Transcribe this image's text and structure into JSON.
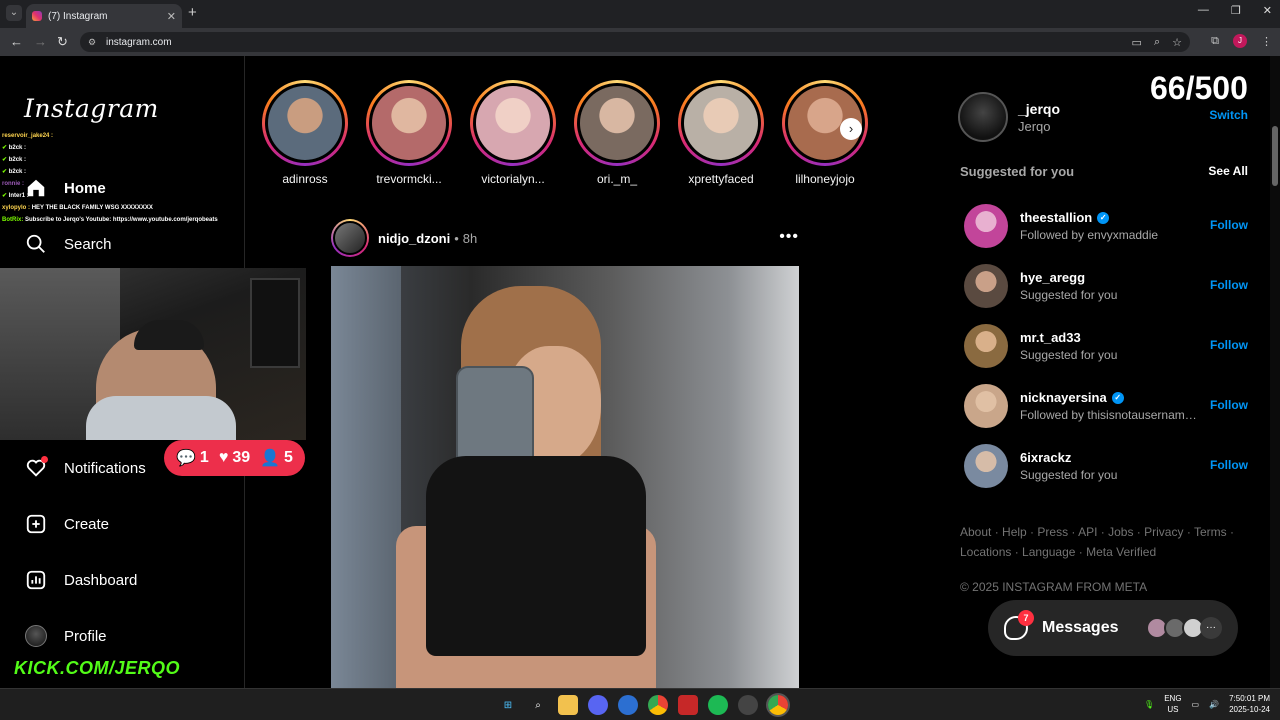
{
  "browser": {
    "tab_title": "(7) Instagram",
    "tab_close": "✕",
    "new_tab": "+",
    "url": "instagram.com",
    "profile_initial": "J"
  },
  "sidebar": {
    "logo": "Instagram",
    "items": [
      {
        "label": "Home",
        "icon": "home-icon"
      },
      {
        "label": "Search",
        "icon": "search-icon"
      },
      {
        "label": "Notifications",
        "icon": "heart-icon"
      },
      {
        "label": "Create",
        "icon": "plus-square-icon"
      },
      {
        "label": "Dashboard",
        "icon": "chart-icon"
      },
      {
        "label": "Profile",
        "icon": "avatar-icon"
      }
    ]
  },
  "overlay": {
    "chat": [
      {
        "user": "reservoir_jake24 :",
        "msg": ""
      },
      {
        "user": "b2ck :",
        "msg": ""
      },
      {
        "user": "b2ck :",
        "msg": ""
      },
      {
        "user": "b2ck :",
        "msg": ""
      },
      {
        "user": "ronnie :",
        "msg": ""
      },
      {
        "user": "Inter1 :",
        "msg": ""
      },
      {
        "user": "xylopylo :",
        "msg": "HEY THE BLACK FAMILY WSG XXXXXXXX"
      },
      {
        "user": "BotRix:",
        "msg": "Subscribe to Jerqo's Youtube: https://www.youtube.com/jerqobeats"
      }
    ],
    "badge": {
      "comments": "1",
      "likes": "39",
      "follows": "5"
    },
    "kick_url": "KICK.COM/JERQO"
  },
  "stories": [
    {
      "name": "adinross",
      "color": "#5b6b7c"
    },
    {
      "name": "trevormcki...",
      "color": "#b46a6a"
    },
    {
      "name": "victorialyn...",
      "color": "#d7a7b0"
    },
    {
      "name": "ori._m_",
      "color": "#7a6a60"
    },
    {
      "name": "xprettyfaced",
      "color": "#b9b0a6"
    },
    {
      "name": "lilhoneyjojo",
      "color": "#a86b4e"
    }
  ],
  "post": {
    "username": "nidjo_dzoni",
    "dot": "•",
    "time": "8h",
    "more": "•••"
  },
  "right": {
    "counter": "66/500",
    "me": {
      "username": "_jerqo",
      "name": "Jerqo",
      "switch": "Switch"
    },
    "suggested_title": "Suggested for you",
    "see_all": "See All",
    "suggestions": [
      {
        "username": "theestallion",
        "sub": "Followed by envyxmaddie",
        "verified": true,
        "follow": "Follow",
        "color": "#c2459a"
      },
      {
        "username": "hye_aregg",
        "sub": "Suggested for you",
        "verified": false,
        "follow": "Follow",
        "color": "#5a4a40"
      },
      {
        "username": "mr.t_ad33",
        "sub": "Suggested for you",
        "verified": false,
        "follow": "Follow",
        "color": "#8a6a40"
      },
      {
        "username": "nicknayersina",
        "sub": "Followed by thisisnotausername...",
        "verified": true,
        "follow": "Follow",
        "color": "#c9a68a"
      },
      {
        "username": "6ixrackz",
        "sub": "Suggested for you",
        "verified": false,
        "follow": "Follow",
        "color": "#7a8aa0"
      }
    ],
    "footer_links": [
      "About",
      "Help",
      "Press",
      "API",
      "Jobs",
      "Privacy",
      "Terms",
      "Locations",
      "Language",
      "Meta Verified"
    ],
    "copyright": "© 2025 INSTAGRAM FROM META",
    "messages": {
      "label": "Messages",
      "badge": "7"
    }
  },
  "taskbar": {
    "lang_1": "ENG",
    "lang_2": "US",
    "time": "7:50:01 PM",
    "date": "2025-10-24"
  },
  "colors": {
    "accent": "#0095f6",
    "badge": "#ed2f4b",
    "kick": "#53fc18"
  }
}
